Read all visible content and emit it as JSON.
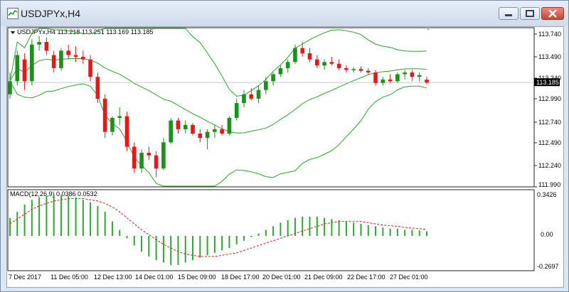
{
  "window": {
    "title": "USDJPYx,H4",
    "minimize_label": "minimize",
    "maximize_label": "maximize",
    "close_label": "close"
  },
  "price_panel": {
    "header": "USDJPYx,H4  113.218 113.251 113.169 113.185",
    "current_price": "113.185",
    "y_ticks": [
      "113.740",
      "113.490",
      "113.240",
      "112.990",
      "112.740",
      "112.490",
      "112.240",
      "111.990"
    ]
  },
  "macd_panel": {
    "header": "MACD(12,26,9) 0.0386 0.0532",
    "y_ticks": [
      "0.3426",
      "0.00",
      "-0.2697"
    ]
  },
  "x_ticks": [
    "7 Dec 2017",
    "11 Dec 05:00",
    "12 Dec 13:00",
    "14 Dec 01:00",
    "15 Dec 09:00",
    "18 Dec 17:00",
    "20 Dec 01:00",
    "21 Dec 09:00",
    "22 Dec 17:00",
    "27 Dec 01:00"
  ],
  "colors": {
    "bull": "#1f8f1f",
    "bear": "#e21a1a",
    "bands": "#2aa52a",
    "signal": "#e21a1a",
    "histogram": "#2fa82f",
    "price_label_bg": "#000000"
  },
  "chart_data": [
    {
      "type": "candlestick",
      "symbol": "USDJPYx",
      "timeframe": "H4",
      "ohlc_last": [
        113.218,
        113.251,
        113.169,
        113.185
      ],
      "ylim": [
        111.99,
        113.86
      ],
      "overlay": "bollinger_bands",
      "candles": [
        {
          "o": 113.05,
          "h": 113.3,
          "l": 113.0,
          "c": 113.2
        },
        {
          "o": 113.2,
          "h": 113.55,
          "l": 113.15,
          "c": 113.5
        },
        {
          "o": 113.45,
          "h": 113.52,
          "l": 113.1,
          "c": 113.2
        },
        {
          "o": 113.2,
          "h": 113.68,
          "l": 113.15,
          "c": 113.62
        },
        {
          "o": 113.62,
          "h": 113.72,
          "l": 113.55,
          "c": 113.65
        },
        {
          "o": 113.65,
          "h": 113.7,
          "l": 113.5,
          "c": 113.55
        },
        {
          "o": 113.5,
          "h": 113.55,
          "l": 113.3,
          "c": 113.35
        },
        {
          "o": 113.35,
          "h": 113.58,
          "l": 113.32,
          "c": 113.55
        },
        {
          "o": 113.55,
          "h": 113.62,
          "l": 113.45,
          "c": 113.5
        },
        {
          "o": 113.5,
          "h": 113.6,
          "l": 113.42,
          "c": 113.48
        },
        {
          "o": 113.48,
          "h": 113.55,
          "l": 113.4,
          "c": 113.45
        },
        {
          "o": 113.45,
          "h": 113.5,
          "l": 113.2,
          "c": 113.25
        },
        {
          "o": 113.25,
          "h": 113.3,
          "l": 112.95,
          "c": 113.0
        },
        {
          "o": 113.0,
          "h": 113.05,
          "l": 112.55,
          "c": 112.62
        },
        {
          "o": 112.62,
          "h": 112.8,
          "l": 112.58,
          "c": 112.78
        },
        {
          "o": 112.78,
          "h": 112.9,
          "l": 112.7,
          "c": 112.8
        },
        {
          "o": 112.8,
          "h": 112.85,
          "l": 112.4,
          "c": 112.45
        },
        {
          "o": 112.45,
          "h": 112.5,
          "l": 112.15,
          "c": 112.2
        },
        {
          "o": 112.2,
          "h": 112.42,
          "l": 112.15,
          "c": 112.38
        },
        {
          "o": 112.38,
          "h": 112.45,
          "l": 112.3,
          "c": 112.35
        },
        {
          "o": 112.35,
          "h": 112.4,
          "l": 112.1,
          "c": 112.2
        },
        {
          "o": 112.2,
          "h": 112.55,
          "l": 112.18,
          "c": 112.5
        },
        {
          "o": 112.5,
          "h": 112.78,
          "l": 112.48,
          "c": 112.75
        },
        {
          "o": 112.75,
          "h": 112.78,
          "l": 112.6,
          "c": 112.65
        },
        {
          "o": 112.65,
          "h": 112.75,
          "l": 112.6,
          "c": 112.7
        },
        {
          "o": 112.7,
          "h": 112.72,
          "l": 112.58,
          "c": 112.6
        },
        {
          "o": 112.6,
          "h": 112.65,
          "l": 112.5,
          "c": 112.55
        },
        {
          "o": 112.55,
          "h": 112.65,
          "l": 112.42,
          "c": 112.62
        },
        {
          "o": 112.62,
          "h": 112.7,
          "l": 112.55,
          "c": 112.65
        },
        {
          "o": 112.65,
          "h": 112.7,
          "l": 112.58,
          "c": 112.6
        },
        {
          "o": 112.6,
          "h": 112.8,
          "l": 112.58,
          "c": 112.78
        },
        {
          "o": 112.78,
          "h": 113.0,
          "l": 112.75,
          "c": 112.95
        },
        {
          "o": 112.95,
          "h": 113.1,
          "l": 112.9,
          "c": 113.05
        },
        {
          "o": 113.05,
          "h": 113.12,
          "l": 112.98,
          "c": 113.0
        },
        {
          "o": 113.0,
          "h": 113.15,
          "l": 112.95,
          "c": 113.1
        },
        {
          "o": 113.1,
          "h": 113.25,
          "l": 113.05,
          "c": 113.2
        },
        {
          "o": 113.2,
          "h": 113.3,
          "l": 113.15,
          "c": 113.28
        },
        {
          "o": 113.28,
          "h": 113.38,
          "l": 113.25,
          "c": 113.35
        },
        {
          "o": 113.35,
          "h": 113.45,
          "l": 113.3,
          "c": 113.42
        },
        {
          "o": 113.42,
          "h": 113.62,
          "l": 113.4,
          "c": 113.58
        },
        {
          "o": 113.58,
          "h": 113.65,
          "l": 113.48,
          "c": 113.52
        },
        {
          "o": 113.52,
          "h": 113.58,
          "l": 113.42,
          "c": 113.45
        },
        {
          "o": 113.45,
          "h": 113.5,
          "l": 113.35,
          "c": 113.38
        },
        {
          "o": 113.38,
          "h": 113.45,
          "l": 113.33,
          "c": 113.42
        },
        {
          "o": 113.42,
          "h": 113.48,
          "l": 113.38,
          "c": 113.4
        },
        {
          "o": 113.4,
          "h": 113.45,
          "l": 113.33,
          "c": 113.35
        },
        {
          "o": 113.35,
          "h": 113.38,
          "l": 113.3,
          "c": 113.33
        },
        {
          "o": 113.33,
          "h": 113.36,
          "l": 113.3,
          "c": 113.34
        },
        {
          "o": 113.34,
          "h": 113.37,
          "l": 113.3,
          "c": 113.32
        },
        {
          "o": 113.32,
          "h": 113.35,
          "l": 113.28,
          "c": 113.3
        },
        {
          "o": 113.3,
          "h": 113.33,
          "l": 113.15,
          "c": 113.18
        },
        {
          "o": 113.18,
          "h": 113.25,
          "l": 113.15,
          "c": 113.22
        },
        {
          "o": 113.22,
          "h": 113.28,
          "l": 113.18,
          "c": 113.2
        },
        {
          "o": 113.2,
          "h": 113.3,
          "l": 113.18,
          "c": 113.28
        },
        {
          "o": 113.28,
          "h": 113.33,
          "l": 113.22,
          "c": 113.3
        },
        {
          "o": 113.3,
          "h": 113.33,
          "l": 113.2,
          "c": 113.25
        },
        {
          "o": 113.25,
          "h": 113.3,
          "l": 113.2,
          "c": 113.27
        },
        {
          "o": 113.218,
          "h": 113.251,
          "l": 113.169,
          "c": 113.185
        }
      ]
    },
    {
      "type": "macd",
      "title": "MACD(12,26,9) 0.0386 0.0532",
      "ylim": [
        -0.2697,
        0.3426
      ],
      "histogram": [
        0.15,
        0.2,
        0.26,
        0.3,
        0.32,
        0.33,
        0.34,
        0.34,
        0.33,
        0.32,
        0.3,
        0.28,
        0.25,
        0.2,
        0.12,
        0.05,
        -0.02,
        -0.08,
        -0.13,
        -0.17,
        -0.2,
        -0.22,
        -0.24,
        -0.24,
        -0.22,
        -0.2,
        -0.18,
        -0.16,
        -0.14,
        -0.12,
        -0.1,
        -0.07,
        -0.04,
        -0.01,
        0.02,
        0.05,
        0.08,
        0.11,
        0.13,
        0.15,
        0.16,
        0.16,
        0.16,
        0.15,
        0.14,
        0.13,
        0.12,
        0.11,
        0.1,
        0.09,
        0.08,
        0.07,
        0.06,
        0.06,
        0.05,
        0.05,
        0.045,
        0.0386
      ],
      "signal": [
        0.1,
        0.14,
        0.18,
        0.22,
        0.25,
        0.27,
        0.29,
        0.3,
        0.31,
        0.31,
        0.31,
        0.3,
        0.29,
        0.27,
        0.24,
        0.2,
        0.15,
        0.1,
        0.05,
        0.01,
        -0.03,
        -0.07,
        -0.1,
        -0.13,
        -0.15,
        -0.16,
        -0.17,
        -0.17,
        -0.17,
        -0.16,
        -0.15,
        -0.14,
        -0.12,
        -0.1,
        -0.08,
        -0.06,
        -0.04,
        -0.02,
        0.0,
        0.02,
        0.04,
        0.06,
        0.08,
        0.1,
        0.11,
        0.12,
        0.12,
        0.12,
        0.12,
        0.11,
        0.1,
        0.09,
        0.085,
        0.08,
        0.07,
        0.065,
        0.06,
        0.0532
      ]
    }
  ]
}
